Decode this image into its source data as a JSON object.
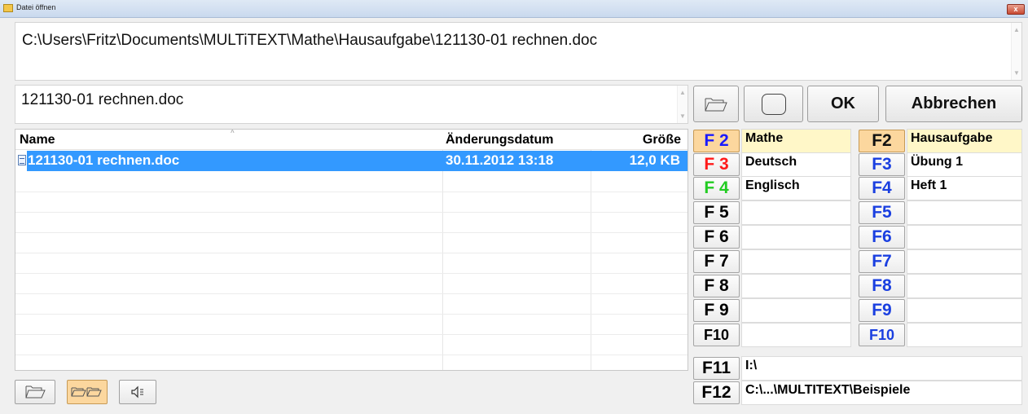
{
  "window": {
    "title": "Datei öffnen",
    "close_label": "x"
  },
  "path": "C:\\Users\\Fritz\\Documents\\MULTiTEXT\\Mathe\\Hausaufgabe\\121130-01 rechnen.doc",
  "filename": "121130-01 rechnen.doc",
  "toolbar": {
    "ok_label": "OK",
    "cancel_label": "Abbrechen"
  },
  "file_list": {
    "columns": {
      "name": "Name",
      "date": "Änderungsdatum",
      "size": "Größe"
    },
    "rows": [
      {
        "name": "121130-01 rechnen.doc",
        "date": "30.11.2012 13:18",
        "size": "12,0 KB"
      }
    ]
  },
  "folders_left": [
    {
      "key": "F 2",
      "label": "Mathe",
      "color": "#1a1aff"
    },
    {
      "key": "F 3",
      "label": "Deutsch",
      "color": "#ff1a1a"
    },
    {
      "key": "F 4",
      "label": "Englisch",
      "color": "#22cc22"
    },
    {
      "key": "F 5",
      "label": "",
      "color": "#111111"
    },
    {
      "key": "F 6",
      "label": "",
      "color": "#111111"
    },
    {
      "key": "F 7",
      "label": "",
      "color": "#111111"
    },
    {
      "key": "F 8",
      "label": "",
      "color": "#111111"
    },
    {
      "key": "F 9",
      "label": "",
      "color": "#111111"
    },
    {
      "key": "F10",
      "label": "",
      "color": "#111111"
    }
  ],
  "folders_right": [
    {
      "key": "F2",
      "label": "Hausaufgabe",
      "color": "#111111"
    },
    {
      "key": "F3",
      "label": "Übung 1",
      "color": "#1a3fe0"
    },
    {
      "key": "F4",
      "label": "Heft 1",
      "color": "#1a3fe0"
    },
    {
      "key": "F5",
      "label": "",
      "color": "#1a3fe0"
    },
    {
      "key": "F6",
      "label": "",
      "color": "#1a3fe0"
    },
    {
      "key": "F7",
      "label": "",
      "color": "#1a3fe0"
    },
    {
      "key": "F8",
      "label": "",
      "color": "#1a3fe0"
    },
    {
      "key": "F9",
      "label": "",
      "color": "#1a3fe0"
    },
    {
      "key": "F10",
      "label": "",
      "color": "#1a3fe0"
    }
  ],
  "drives": [
    {
      "key": "F11",
      "label": "I:\\"
    },
    {
      "key": "F12",
      "label": "C:\\...\\MULTITEXT\\Beispiele"
    }
  ],
  "colors": {
    "selection": "#3399ff",
    "highlight_key": "#fcd79e",
    "highlight_cell": "#fff7c8"
  }
}
